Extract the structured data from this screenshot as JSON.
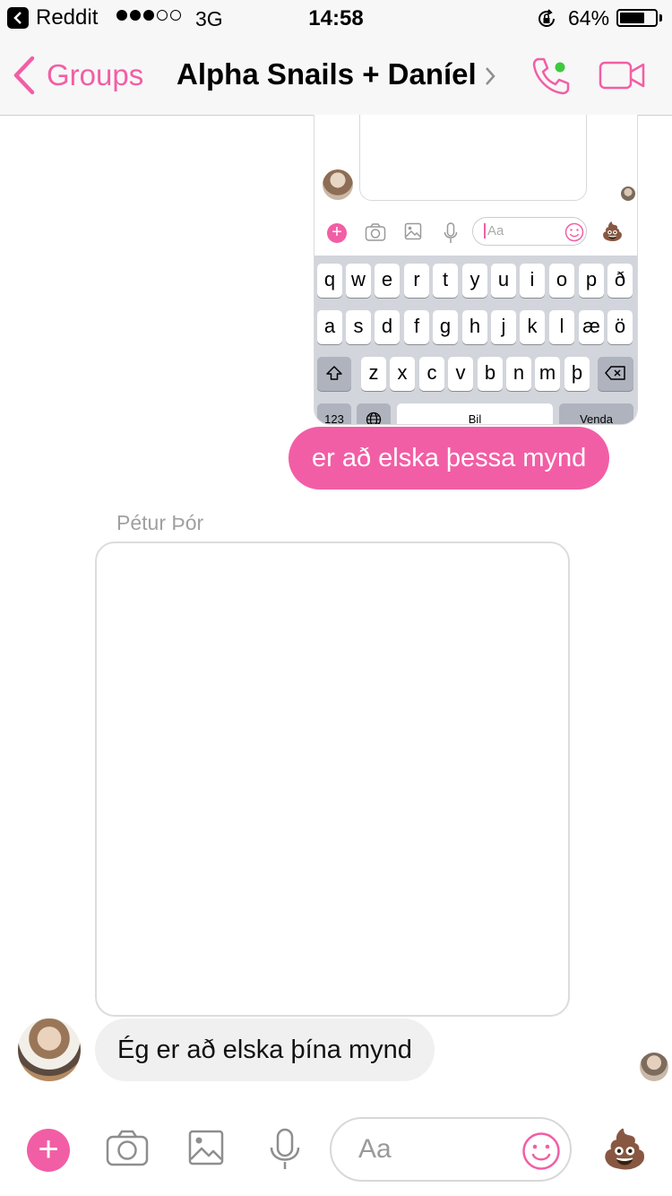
{
  "status_bar": {
    "back_app": "Reddit",
    "carrier_signal_bars": 3,
    "network": "3G",
    "time": "14:58",
    "battery": "64%",
    "battery_level": 0.64
  },
  "nav": {
    "back_label": "Groups",
    "title": "Alpha Snails + Daníel",
    "accent_color": "#f25ea5"
  },
  "thread": {
    "screenshot_message": {
      "input_placeholder": "Aa",
      "keyboard": {
        "row1": [
          "q",
          "w",
          "e",
          "r",
          "t",
          "y",
          "u",
          "i",
          "o",
          "p",
          "ð"
        ],
        "row2": [
          "a",
          "s",
          "d",
          "f",
          "g",
          "h",
          "j",
          "k",
          "l",
          "æ",
          "ö"
        ],
        "row3": [
          "z",
          "x",
          "c",
          "v",
          "b",
          "n",
          "m",
          "þ"
        ],
        "row4": [
          "123",
          "Bil",
          "Venda"
        ]
      }
    },
    "sent_message": "er að elska þessa mynd",
    "sender_name": "Pétur Þór",
    "received_message": "Ég er að elska þína mynd"
  },
  "composer": {
    "placeholder": "Aa"
  }
}
